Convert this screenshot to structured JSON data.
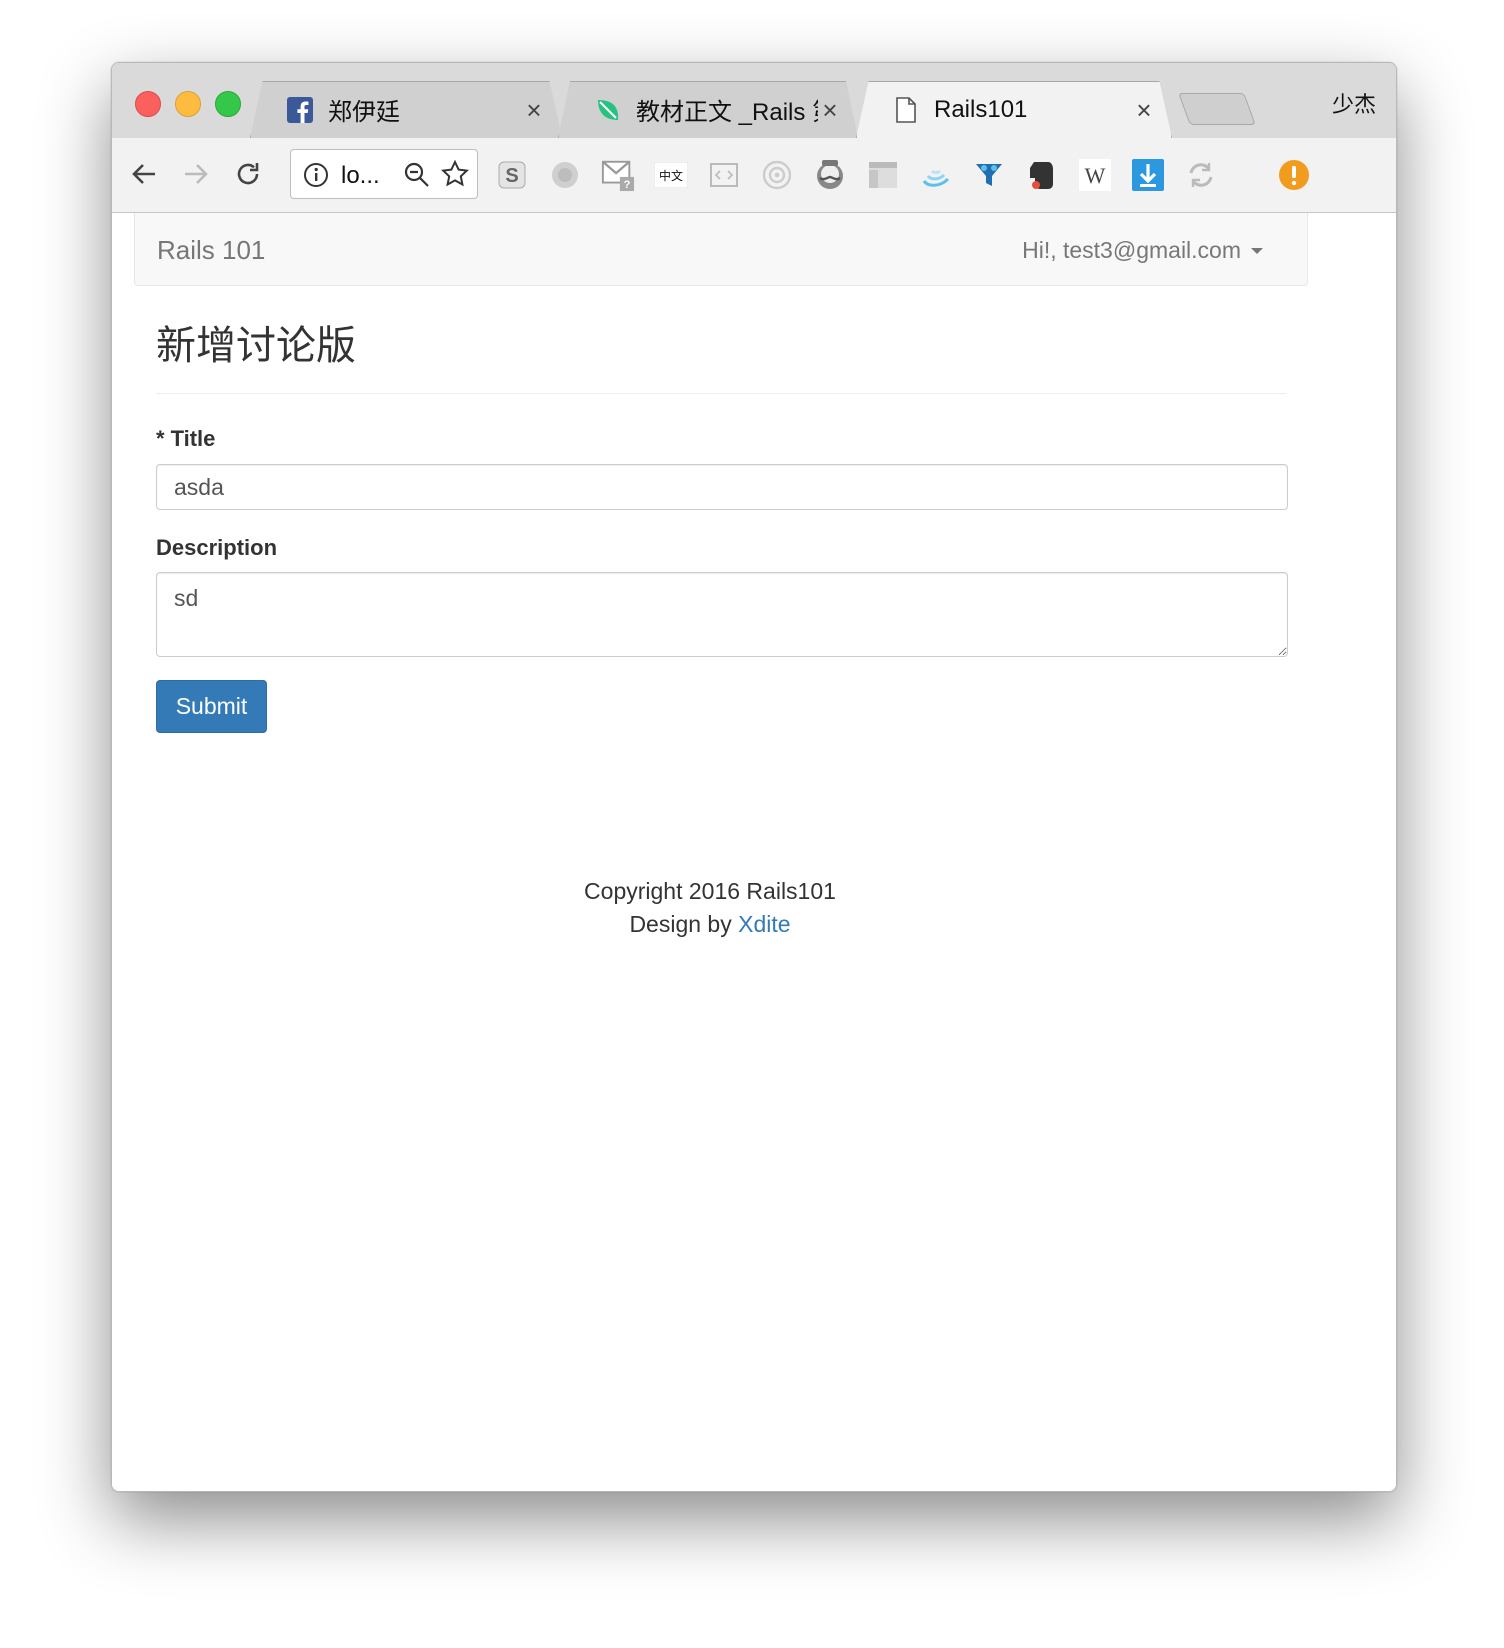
{
  "browser": {
    "tabs": [
      {
        "label": "郑伊廷",
        "favicon": "facebook-icon"
      },
      {
        "label": "教材正文 _Rails 第三",
        "favicon": "leaf-icon"
      },
      {
        "label": "Rails101",
        "favicon": "page-icon"
      }
    ],
    "profile_name": "少杰",
    "url": "lo...",
    "extensions": [
      "s-icon",
      "circle-icon",
      "gmail-help-icon",
      "chinese-text-icon",
      "code-icon",
      "target-icon",
      "mustache-icon",
      "layout-icon",
      "wave-icon",
      "funnel-icon",
      "evernote-icon",
      "wikipedia-icon",
      "download-icon",
      "sync-icon",
      "alert-icon"
    ]
  },
  "navbar": {
    "brand": "Rails 101",
    "user": "Hi!, test3@gmail.com"
  },
  "main": {
    "heading": "新增讨论版",
    "title_label": "Title",
    "title_required_mark": "*",
    "title_value": "asda",
    "description_label": "Description",
    "description_value": "sd",
    "submit_label": "Submit"
  },
  "footer": {
    "copyright": "Copyright 2016 Rails101",
    "design_prefix": "Design by",
    "design_link": "Xdite"
  },
  "colors": {
    "primary": "#337ab7",
    "text": "#333333",
    "navbar_text": "#777777"
  }
}
